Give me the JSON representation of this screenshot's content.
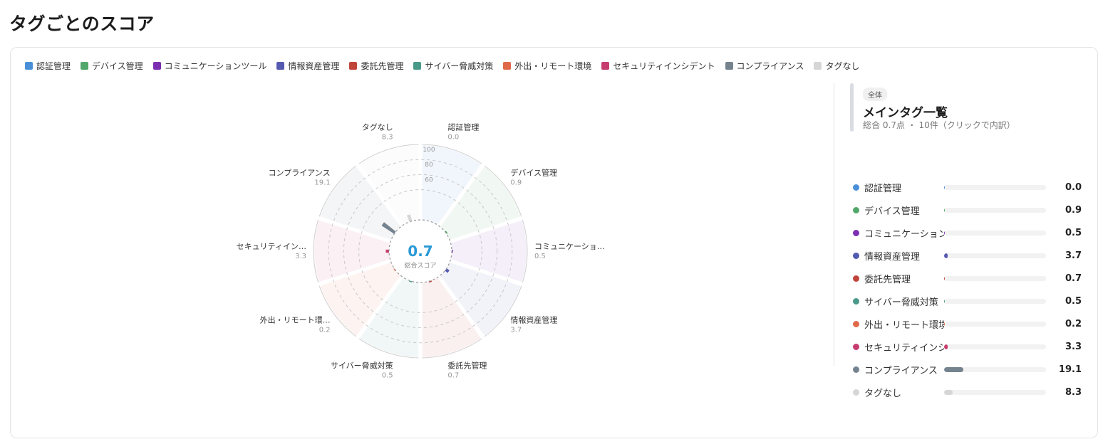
{
  "page": {
    "title": "タグごとのスコア"
  },
  "legend": [
    {
      "label": "認証管理",
      "color": "#4a90d9"
    },
    {
      "label": "デバイス管理",
      "color": "#52a86b"
    },
    {
      "label": "コミュニケーションツール",
      "color": "#7b2fb0"
    },
    {
      "label": "情報資産管理",
      "color": "#5559b0"
    },
    {
      "label": "委託先管理",
      "color": "#c0443a"
    },
    {
      "label": "サイバー脅威対策",
      "color": "#4a9a8a"
    },
    {
      "label": "外出・リモート環境",
      "color": "#e0694a"
    },
    {
      "label": "セキュリティインシデント",
      "color": "#c73c6e"
    },
    {
      "label": "コンプライアンス",
      "color": "#75838f"
    },
    {
      "label": "タグなし",
      "color": "#d6d6d6"
    }
  ],
  "center": {
    "score": "0.7",
    "label": "総合スコア",
    "score_color": "#2a9ad6"
  },
  "chart_data": {
    "type": "polar-bar",
    "categories": [
      "認証管理",
      "デバイス管理",
      "コミュニケーションツール",
      "情報資産管理",
      "委託先管理",
      "サイバー脅威対策",
      "外出・リモート環境",
      "セキュリティインシデント",
      "コンプライアンス",
      "タグなし"
    ],
    "labels": [
      "認証管理",
      "デバイス管理",
      "コミュニケーショ…",
      "情報資産管理",
      "委託先管理",
      "サイバー脅威対策",
      "外出・リモート環…",
      "セキュリティイン…",
      "コンプライアンス",
      "タグなし"
    ],
    "values": [
      0.0,
      0.9,
      0.5,
      3.7,
      0.7,
      0.5,
      0.2,
      3.3,
      19.1,
      8.3
    ],
    "value_labels": [
      "0.0",
      "0.9",
      "0.5",
      "3.7",
      "0.7",
      "0.5",
      "0.2",
      "3.3",
      "19.1",
      "8.3"
    ],
    "radial_ticks": [
      "60",
      "80",
      "100"
    ],
    "rlim": [
      0,
      100
    ],
    "average": 0.7
  },
  "side": {
    "chip": "全体",
    "title": "メインタグ一覧",
    "subtitle": "総合 0.7点 ・ 10件（クリックで内訳）",
    "rows": [
      {
        "name": "認証管理",
        "value": "0.0",
        "score": 0.0
      },
      {
        "name": "デバイス管理",
        "value": "0.9",
        "score": 0.9
      },
      {
        "name": "コミュニケーション",
        "value": "0.5",
        "score": 0.5
      },
      {
        "name": "情報資産管理",
        "value": "3.7",
        "score": 3.7
      },
      {
        "name": "委託先管理",
        "value": "0.7",
        "score": 0.7
      },
      {
        "name": "サイバー脅威対策",
        "value": "0.5",
        "score": 0.5
      },
      {
        "name": "外出・リモート環境",
        "value": "0.2",
        "score": 0.2
      },
      {
        "name": "セキュリティインシ",
        "value": "3.3",
        "score": 3.3
      },
      {
        "name": "コンプライアンス",
        "value": "19.1",
        "score": 19.1
      },
      {
        "name": "タグなし",
        "value": "8.3",
        "score": 8.3
      }
    ]
  }
}
